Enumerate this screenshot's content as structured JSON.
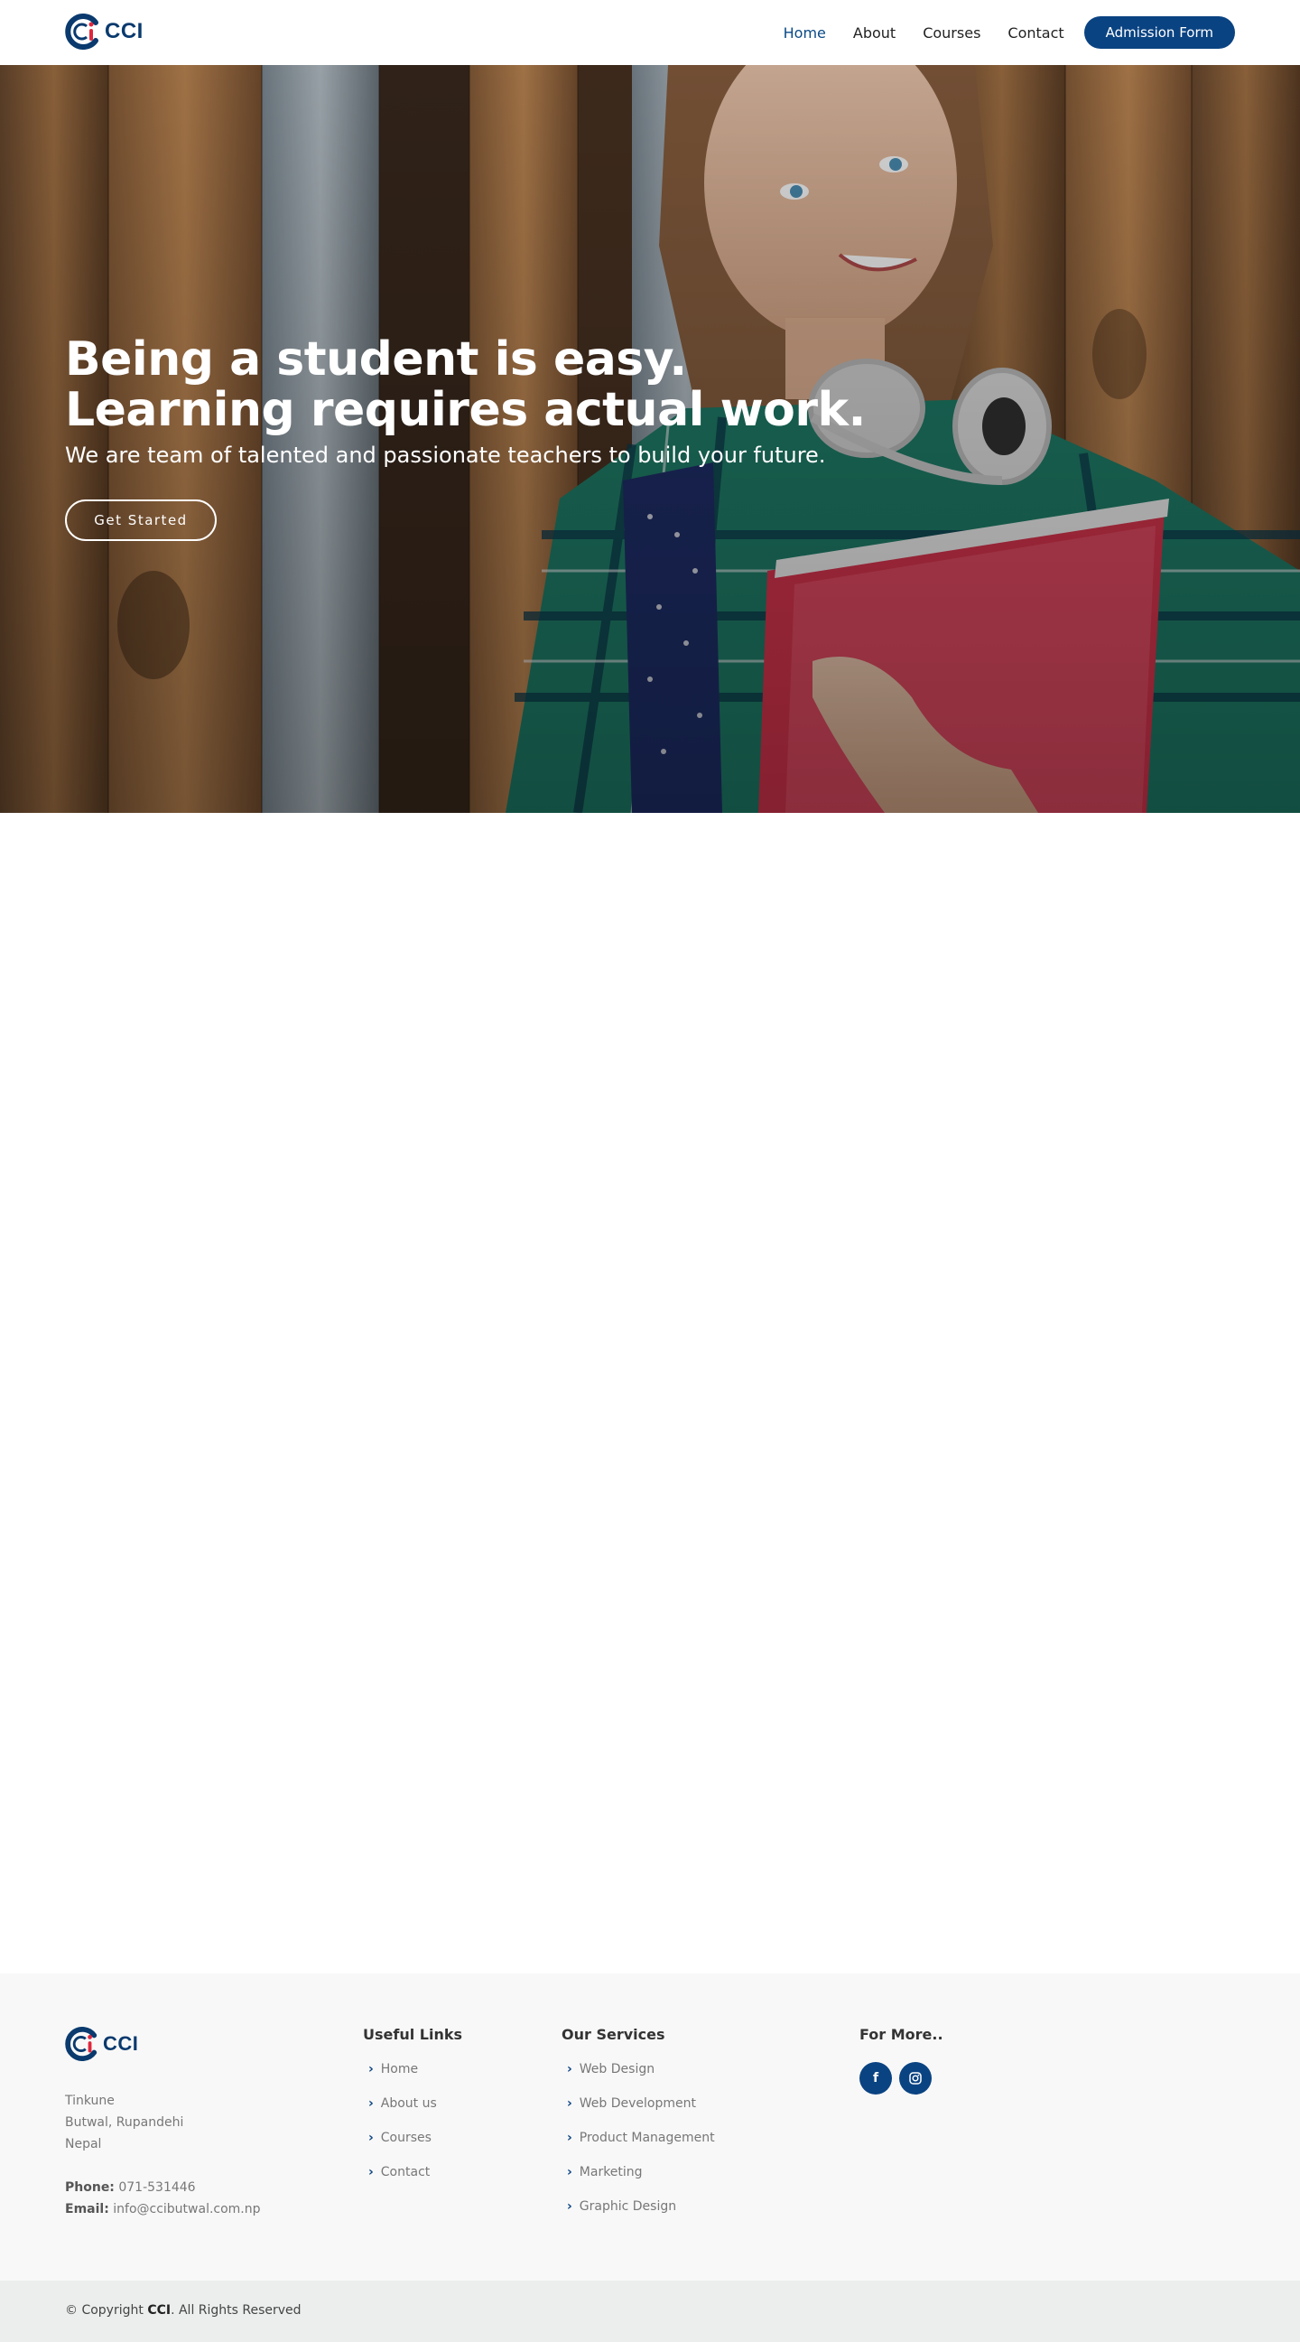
{
  "brand": {
    "name": "CCI"
  },
  "nav": {
    "items": [
      {
        "label": "Home",
        "active": true
      },
      {
        "label": "About",
        "active": false
      },
      {
        "label": "Courses",
        "active": false
      },
      {
        "label": "Contact",
        "active": false
      }
    ],
    "cta_label": "Admission Form"
  },
  "hero": {
    "title_line1": "Being a student is easy.",
    "title_line2": "Learning requires actual work.",
    "subtitle": "We are team of talented and passionate teachers to build your future.",
    "button_label": "Get Started"
  },
  "footer": {
    "address": [
      "Tinkune",
      "Butwal, Rupandehi",
      "Nepal"
    ],
    "phone_label": "Phone:",
    "phone": "071-531446",
    "email_label": "Email:",
    "email": "info@ccibutwal.com.np",
    "useful_links": {
      "title": "Useful Links",
      "items": [
        "Home",
        "About us",
        "Courses",
        "Contact"
      ]
    },
    "services": {
      "title": "Our Services",
      "items": [
        "Web Design",
        "Web Development",
        "Product Management",
        "Marketing",
        "Graphic Design"
      ]
    },
    "more": {
      "title": "For More..",
      "social": [
        {
          "icon": "facebook-icon",
          "glyph": "f"
        },
        {
          "icon": "instagram-icon",
          "glyph": "◎"
        }
      ]
    },
    "copyright_prefix": "© Copyright",
    "copyright_brand": "CCI",
    "copyright_suffix": ". All Rights Reserved"
  },
  "colors": {
    "primary": "#0a4382",
    "accent": "#e0263c",
    "footer_bg": "#f8f8f8",
    "footer_bottom_bg": "#eceded"
  }
}
